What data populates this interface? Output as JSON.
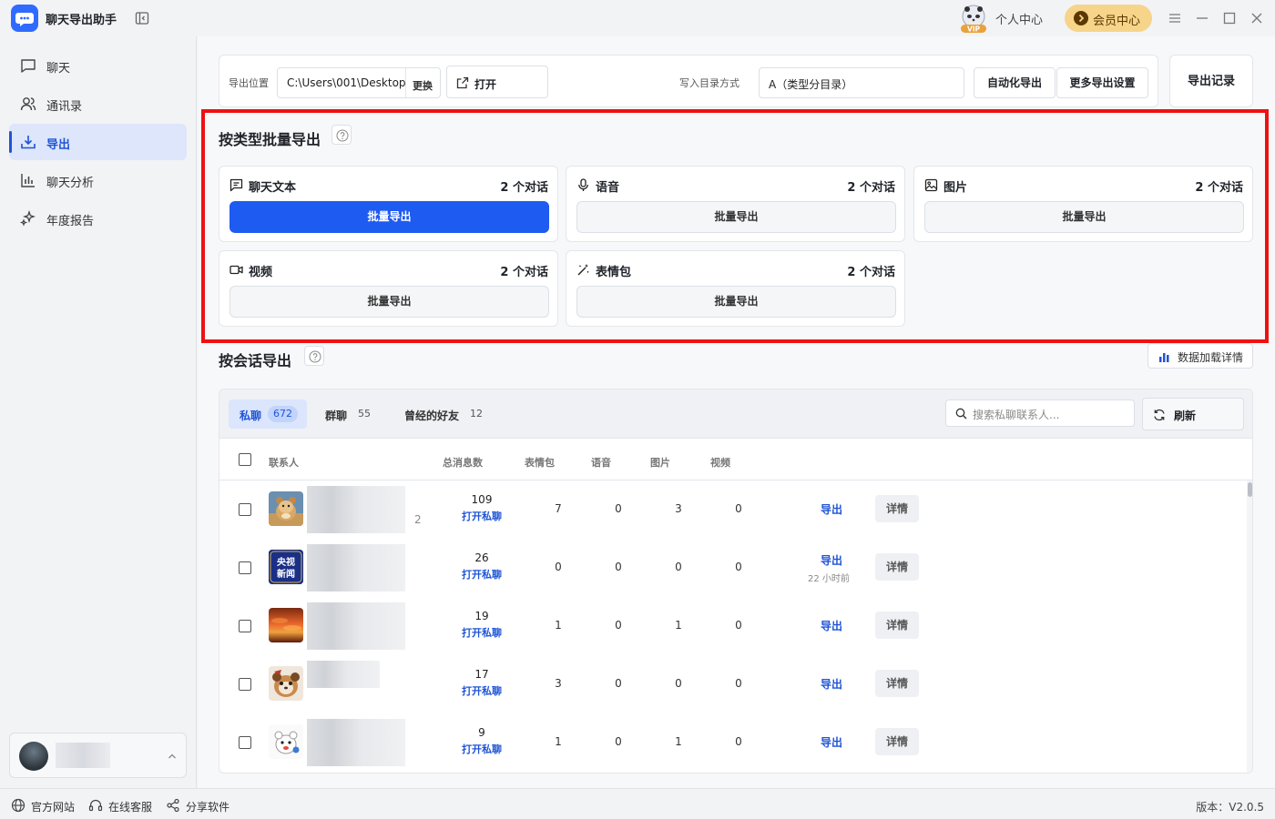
{
  "app": {
    "title": "聊天导出助手",
    "vip_badge": "VIP",
    "personal_center": "个人中心",
    "member_center": "会员中心"
  },
  "sidebar": {
    "items": [
      {
        "label": "聊天",
        "icon": "chat-icon"
      },
      {
        "label": "通讯录",
        "icon": "contacts-icon"
      },
      {
        "label": "导出",
        "icon": "export-icon",
        "active": true
      },
      {
        "label": "聊天分析",
        "icon": "analysis-icon"
      },
      {
        "label": "年度报告",
        "icon": "sparkle-icon"
      }
    ]
  },
  "toolbar": {
    "export_location_label": "导出位置",
    "export_path": "C:\\Users\\001\\Desktop",
    "change_label": "更换",
    "open_label": "打开",
    "dir_mode_label": "写入目录方式",
    "dir_mode_value": "A（类型分目录）",
    "auto_export_label": "自动化导出",
    "more_settings_label": "更多导出设置",
    "export_record_label": "导出记录"
  },
  "batch": {
    "title": "按类型批量导出",
    "types": [
      {
        "name": "聊天文本",
        "count": "2 个对话",
        "button": "批量导出",
        "icon": "text-message-icon",
        "primary": true
      },
      {
        "name": "语音",
        "count": "2 个对话",
        "button": "批量导出",
        "icon": "microphone-icon"
      },
      {
        "name": "图片",
        "count": "2 个对话",
        "button": "批量导出",
        "icon": "image-icon"
      },
      {
        "name": "视频",
        "count": "2 个对话",
        "button": "批量导出",
        "icon": "video-icon"
      },
      {
        "name": "表情包",
        "count": "2 个对话",
        "button": "批量导出",
        "icon": "magic-wand-icon"
      }
    ]
  },
  "conversation": {
    "title": "按会话导出",
    "data_detail_label": "数据加载详情",
    "tabs": [
      {
        "label": "私聊",
        "count": "672",
        "active": true
      },
      {
        "label": "群聊",
        "count": "55"
      },
      {
        "label": "曾经的好友",
        "count": "12"
      }
    ],
    "search_placeholder": "搜索私聊联系人...",
    "refresh_label": "刷新",
    "columns": {
      "contact": "联系人",
      "total": "总消息数",
      "stickers": "表情包",
      "voice": "语音",
      "images": "图片",
      "video": "视频"
    },
    "rows": [
      {
        "total": "109",
        "open": "打开私聊",
        "stickers": "7",
        "voice": "0",
        "images": "3",
        "video": "0",
        "export": "导出",
        "ago": "",
        "detail": "详情",
        "name_suffix": "2"
      },
      {
        "total": "26",
        "open": "打开私聊",
        "stickers": "0",
        "voice": "0",
        "images": "0",
        "video": "0",
        "export": "导出",
        "ago": "22 小时前",
        "detail": "详情",
        "name_suffix": ""
      },
      {
        "total": "19",
        "open": "打开私聊",
        "stickers": "1",
        "voice": "0",
        "images": "1",
        "video": "0",
        "export": "导出",
        "ago": "",
        "detail": "详情",
        "name_suffix": ""
      },
      {
        "total": "17",
        "open": "打开私聊",
        "stickers": "3",
        "voice": "0",
        "images": "0",
        "video": "0",
        "export": "导出",
        "ago": "",
        "detail": "详情",
        "name_suffix": ""
      },
      {
        "total": "9",
        "open": "打开私聊",
        "stickers": "1",
        "voice": "0",
        "images": "1",
        "video": "0",
        "export": "导出",
        "ago": "",
        "detail": "详情",
        "name_suffix": ""
      }
    ],
    "news_avatar_text": [
      "央视",
      "新闻"
    ]
  },
  "footer": {
    "website": "官方网站",
    "support": "在线客服",
    "share": "分享软件",
    "version": "版本：V2.0.5"
  },
  "colors": {
    "accent": "#1e5bf0",
    "highlight_border": "#ee1111",
    "member_gold": "#f6d48a"
  }
}
